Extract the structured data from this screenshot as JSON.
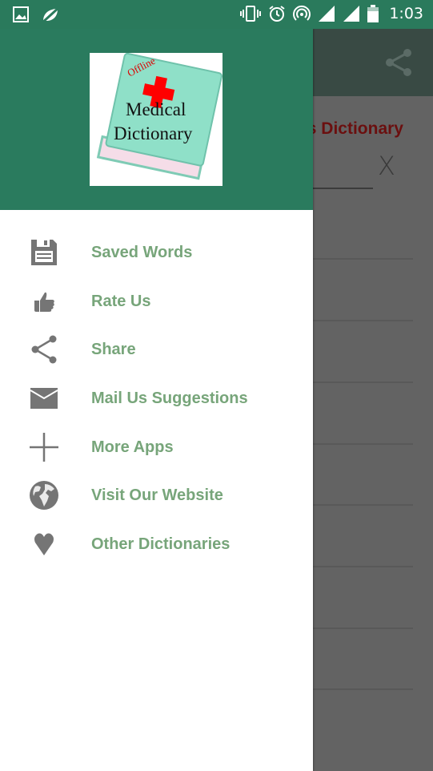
{
  "status_bar": {
    "time": "1:03",
    "icons": [
      "image-icon",
      "no-signal-leaf-icon",
      "vibrate-icon",
      "alarm-icon",
      "hotspot-icon",
      "signal-icon",
      "signal-icon",
      "battery-icon"
    ]
  },
  "background": {
    "title": "s Dictionary",
    "clear_label": "X"
  },
  "drawer": {
    "logo": {
      "tag": "Offline",
      "line1": "Medical",
      "line2": "Dictionary"
    },
    "items": [
      {
        "label": "Saved Words",
        "icon": "floppy-disk-icon"
      },
      {
        "label": "Rate Us",
        "icon": "thumbs-up-icon"
      },
      {
        "label": "Share",
        "icon": "share-icon"
      },
      {
        "label": "Mail Us Suggestions",
        "icon": "envelope-icon"
      },
      {
        "label": "More Apps",
        "icon": "plus-icon"
      },
      {
        "label": "Visit Our Website",
        "icon": "globe-icon"
      },
      {
        "label": "Other Dictionaries",
        "icon": "heart-icon"
      }
    ]
  },
  "colors": {
    "primary": "#2a7b5e",
    "item_text": "#77a57a",
    "icon": "#757575",
    "scrim": "#636363",
    "title_red": "#6b0f0f"
  }
}
